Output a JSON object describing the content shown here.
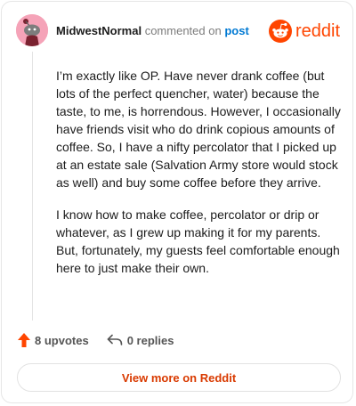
{
  "comment": {
    "username": "MidwestNormal",
    "action_text": "commented on",
    "link_text": "post",
    "paragraphs": [
      "I’m exactly like OP. Have never drank coffee (but lots of the perfect quencher, water) because the taste, to me, is horrendous. However, I occasionally have friends visit who do drink copious amounts of coffee. So, I have a nifty percolator that I picked up at an estate sale (Salvation Army store would stock as well) and buy some coffee before they arrive.",
      "I know how to make coffee, percolator or drip or whatever, as I grew up making it for my parents. But, fortunately, my guests feel comfortable enough here to just make their own."
    ]
  },
  "brand": {
    "name": "reddit",
    "accent_color": "#ff4500"
  },
  "stats": {
    "upvotes_label": "8 upvotes",
    "replies_label": "0 replies"
  },
  "cta": {
    "view_more_label": "View more on Reddit"
  },
  "icons": {
    "avatar": "snoo-avatar-icon",
    "brand": "reddit-logo-icon",
    "upvote": "upvote-arrow-icon",
    "reply": "reply-arrow-icon"
  },
  "colors": {
    "upvote": "#ff4500",
    "link": "#0079d3",
    "cta_text": "#d93a00",
    "avatar_bg": "#f5a3b8"
  }
}
